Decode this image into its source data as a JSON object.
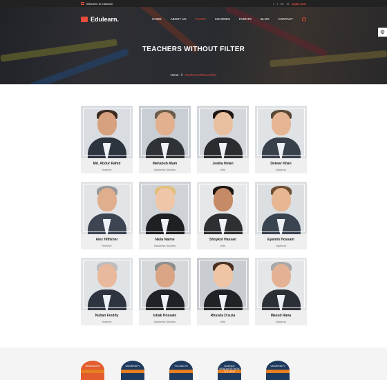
{
  "topbar": {
    "welcome": "Welcome to Edulearn",
    "social_icons": [
      "facebook-icon",
      "twitter-icon",
      "google-plus-icon",
      "linkedin-icon"
    ],
    "apply": "Apply Now"
  },
  "nav": {
    "logo": "Edulearn.",
    "items": [
      "HOME",
      "ABOUT US",
      "PAGES",
      "COURSES",
      "EVENTS",
      "BLOG",
      "CONTACT"
    ],
    "active": "PAGES"
  },
  "hero": {
    "title": "TEACHERS WITHOUT FILTER",
    "breadcrumb_home": "Home",
    "breadcrumb_sep": "//",
    "breadcrumb_current": "Teachers Without Filter"
  },
  "colors": {
    "accent": "#e74c3c",
    "dark": "#222222",
    "navy": "#1f3a5f"
  },
  "teachers": [
    {
      "name": "Md. Abdur Rahid",
      "dept": "Science"
    },
    {
      "name": "Mahabub Alam",
      "dept": "Business Studies"
    },
    {
      "name": "Jesika Helan",
      "dept": "Arts"
    },
    {
      "name": "Delwar Khan",
      "dept": "Diploma"
    },
    {
      "name": "Alex Hilfisher",
      "dept": "Science"
    },
    {
      "name": "Naila Naime",
      "dept": "Business Studies"
    },
    {
      "name": "Shoykot Hassan",
      "dept": "Arts"
    },
    {
      "name": "Eyamin Hossain",
      "dept": "Diploma"
    },
    {
      "name": "Nuhan Freddy",
      "dept": "Science"
    },
    {
      "name": "Istiak Hossain",
      "dept": "Business Studies"
    },
    {
      "name": "Rhusda D'suza",
      "dept": "Arts"
    },
    {
      "name": "Masud Rana",
      "dept": "Diploma"
    }
  ],
  "badges": [
    "GRADUATES",
    "UNIVERSITY",
    "YOU DID IT!",
    "SCIENCE GRADUATE HIGH COLLEGE",
    "UNIVERSITY"
  ]
}
